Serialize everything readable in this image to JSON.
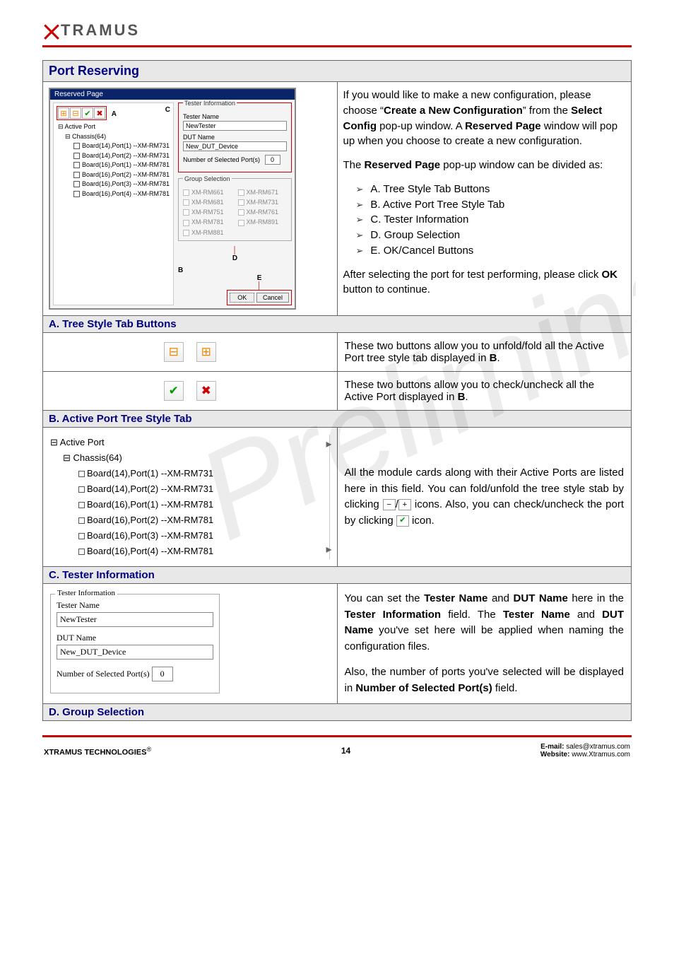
{
  "logo": {
    "x_text": "X",
    "rest": "TRAMUS"
  },
  "section": {
    "title": "Port Reserving"
  },
  "reserved_window": {
    "title": "Reserved Page",
    "tree": {
      "root": "Active Port",
      "chassis": "Chassis(64)",
      "items": [
        "Board(14),Port(1) --XM-RM731",
        "Board(14),Port(2) --XM-RM731",
        "Board(16),Port(1) --XM-RM781",
        "Board(16),Port(2) --XM-RM781",
        "Board(16),Port(3) --XM-RM781",
        "Board(16),Port(4) --XM-RM781"
      ]
    },
    "labels": {
      "A": "A",
      "B": "B",
      "C": "C",
      "D": "D",
      "E": "E"
    },
    "tester_info": {
      "legend": "Tester Information",
      "name_label": "Tester Name",
      "name_value": "NewTester",
      "dut_label": "DUT Name",
      "dut_value": "New_DUT_Device",
      "ports_label": "Number of Selected Port(s)",
      "ports_value": "0"
    },
    "group": {
      "legend": "Group Selection",
      "items": [
        "XM-RM661",
        "XM-RM671",
        "XM-RM681",
        "XM-RM731",
        "XM-RM751",
        "XM-RM761",
        "XM-RM781",
        "XM-RM891",
        "XM-RM881"
      ]
    },
    "buttons": {
      "ok": "OK",
      "cancel": "Cancel"
    }
  },
  "intro": {
    "p1a": "If you would like to make a new configuration, please choose “",
    "p1b": "Create a New Configuration",
    "p1c": "” from the ",
    "p1d": "Select Config",
    "p1e": " pop-up window. A ",
    "p1f": "Reserved Page",
    "p1g": " window will pop up when you choose to create a new configuration.",
    "p2a": "The ",
    "p2b": "Reserved Page",
    "p2c": " pop-up window can be divided as:",
    "list": [
      "A. Tree Style Tab Buttons",
      "B. Active Port Tree Style Tab",
      "C. Tester Information",
      "D. Group Selection",
      "E. OK/Cancel Buttons"
    ],
    "p3a": "After selecting the port for test performing, please click ",
    "p3b": "OK",
    "p3c": " button to continue."
  },
  "sectionA": {
    "header": "A. Tree Style Tab Buttons",
    "row1a": "These two buttons allow you to unfold/fold all the Active Port tree style tab displayed in ",
    "row1b": "B",
    "row1c": ".",
    "row2a": "These two buttons allow you to check/uncheck all the Active Port displayed in ",
    "row2b": "B",
    "row2c": "."
  },
  "sectionB": {
    "header": "B. Active Port Tree Style Tab",
    "tree": {
      "root": "Active Port",
      "chassis": "Chassis(64)",
      "items": [
        "Board(14),Port(1) --XM-RM731",
        "Board(14),Port(2) --XM-RM731",
        "Board(16),Port(1) --XM-RM781",
        "Board(16),Port(2) --XM-RM781",
        "Board(16),Port(3) --XM-RM781",
        "Board(16),Port(4) --XM-RM781"
      ]
    },
    "text1": "All the module cards along with their Active Ports are listed here in this field. You can fold/unfold the tree style stab by clicking ",
    "text2": " icons. Also, you can check/uncheck the port by clicking ",
    "text3": " icon."
  },
  "sectionC": {
    "header": "C. Tester Information",
    "box": {
      "legend": "Tester Information",
      "name_label": "Tester Name",
      "name_value": "NewTester",
      "dut_label": "DUT Name",
      "dut_value": "New_DUT_Device",
      "ports_label": "Number of Selected Port(s)",
      "ports_value": "0"
    },
    "p1a": "You can set the ",
    "p1b": "Tester Name",
    "p1c": " and ",
    "p1d": "DUT Name",
    "p1e": " here in the ",
    "p1f": "Tester Information",
    "p1g": " field. The ",
    "p1h": "Tester Name",
    "p1i": " and ",
    "p1j": "DUT Name",
    "p1k": " you've set here will be applied when naming the configuration files.",
    "p2a": "Also, the number of ports you've selected will be displayed in ",
    "p2b": "Number of Selected Port(s)",
    "p2c": " field."
  },
  "sectionD": {
    "header": "D. Group Selection"
  },
  "footer": {
    "left": "XTRAMUS TECHNOLOGIES",
    "reg": "®",
    "page": "14",
    "email_label": "E-mail: ",
    "email": "sales@xtramus.com",
    "web_label": "Website:  ",
    "web": "www.Xtramus.com"
  }
}
